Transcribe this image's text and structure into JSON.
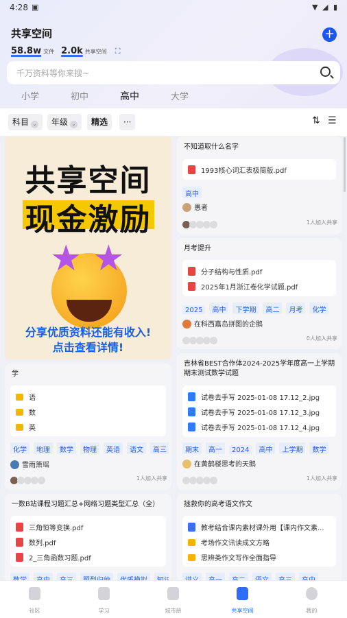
{
  "status": {
    "time": "4:28"
  },
  "header": {
    "title": "共享空间",
    "add_label": "+"
  },
  "stats": {
    "files_count": "58.8w",
    "files_label": "文件",
    "spaces_count": "2.0k",
    "spaces_label": "共享空间",
    "icon": "network-icon"
  },
  "search": {
    "placeholder": "千万资料等你来搜~"
  },
  "level_tabs": [
    "小学",
    "初中",
    "高中",
    "大学"
  ],
  "level_active": 2,
  "filters": {
    "subject": "科目",
    "grade": "年级",
    "featured": "精选",
    "more": "···"
  },
  "banner": {
    "line1": "共享空间",
    "line2": "现金激励",
    "cta1": "分享优质资料还能有收入!",
    "cta2": "点击查看详情!"
  },
  "cards": [
    {
      "title": "不知道取什么名字",
      "files": [
        "1993核心词汇表极简版.pdf"
      ],
      "tags": [
        "高中"
      ],
      "author": "愚者",
      "joined": "1人加入共享"
    },
    {
      "title": "月考提升",
      "files": [
        "分子结构与性质.pdf",
        "2025年1月浙江卷化学试题.pdf"
      ],
      "tags": [
        "2025",
        "高中",
        "下学期",
        "高二",
        "月考",
        "化学"
      ],
      "author": "在科西嘉岛拼图的企鹅",
      "joined": "0人加入共享"
    },
    {
      "title": "学",
      "files": [
        "语",
        "数",
        "英"
      ],
      "tags": [
        "化学",
        "地理",
        "数学",
        "物理",
        "英语",
        "语文",
        "高三"
      ],
      "author": "雪雨箫瑶",
      "joined": "1人加入共享"
    },
    {
      "title": "吉林省BEST合作体2024-2025学年度高一上学期期末测试数学试题",
      "files": [
        "试卷去手写 2025-01-08 17.12_2.jpg",
        "试卷去手写 2025-01-08 17.12_3.jpg",
        "试卷去手写 2025-01-08 17.12_4.jpg"
      ],
      "tags": [
        "期末",
        "高一",
        "2024",
        "高中",
        "上学期",
        "数学"
      ],
      "author": "在黄鹤楼思考的天鹅",
      "joined": "1人加入共享"
    },
    {
      "title": "一数B站课程习题汇总+网络习题类型汇总（全）",
      "files": [
        "三角恒等变换.pdf",
        "数列.pdf",
        "2_三角函数习题.pdf"
      ],
      "tags": [
        "数学",
        "高中",
        "高三",
        "题型归纳",
        "优质模拟",
        "知识"
      ]
    },
    {
      "title": "拯救你的高考语文作文",
      "files": [
        "教考结合课内素材课外用【课内作文素...",
        "考场作文讯读成文方略",
        "思辨类作文写作全面指导"
      ],
      "tags": [
        "讲义",
        "高一",
        "高二",
        "语文",
        "高三",
        "高中"
      ]
    }
  ],
  "nav": [
    {
      "label": "社区",
      "icon": "community-icon"
    },
    {
      "label": "学习",
      "icon": "study-icon"
    },
    {
      "label": "城市册",
      "icon": "notebook-icon"
    },
    {
      "label": "共享空间",
      "icon": "shared-space-icon"
    },
    {
      "label": "我的",
      "icon": "profile-icon"
    }
  ],
  "nav_active": 3,
  "colors": {
    "accent": "#1a56f0",
    "tag_text": "#2a5de0",
    "tag_bg": "#e6edfb",
    "pdf": "#e84444",
    "jpg": "#2f7bf5",
    "folder": "#f4b400"
  }
}
